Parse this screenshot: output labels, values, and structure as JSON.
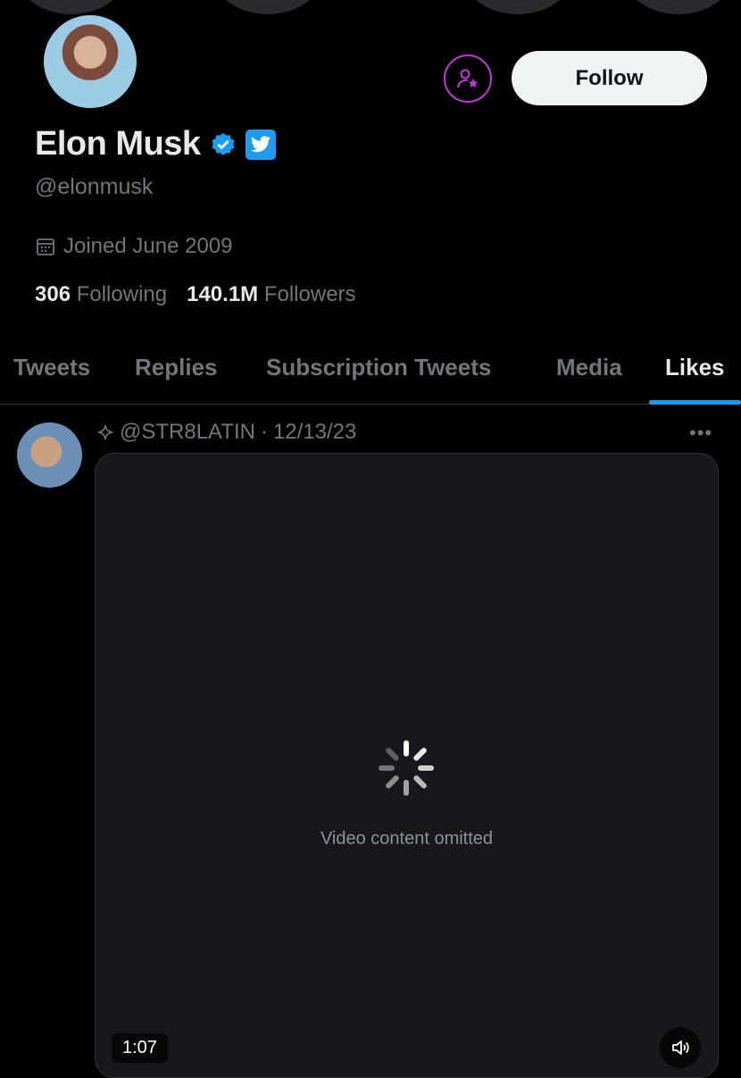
{
  "profile": {
    "name": "Elon Musk",
    "handle": "@elonmusk",
    "joined": "Joined June 2009",
    "following_count": "306",
    "following_label": "Following",
    "followers_count": "140.1M",
    "followers_label": "Followers",
    "follow_button": "Follow"
  },
  "tabs": [
    {
      "label": "Tweets"
    },
    {
      "label": "Replies"
    },
    {
      "label": "Subscription Tweets"
    },
    {
      "label": "Media"
    },
    {
      "label": "Likes"
    }
  ],
  "active_tab": "Likes",
  "tweet": {
    "handle": "@STR8LATIN",
    "separator": "·",
    "date": "12/13/23",
    "media": {
      "duration": "1:07",
      "note": "Video content omitted"
    }
  },
  "colors": {
    "accent": "#1d9bf0",
    "subscribe_ring": "#c23ad6"
  },
  "icons": [
    "subscribe-icon",
    "verified-icon",
    "twitter-bird-icon",
    "calendar-icon",
    "sparkle-icon",
    "more-icon",
    "loading-spinner-icon",
    "volume-icon"
  ]
}
